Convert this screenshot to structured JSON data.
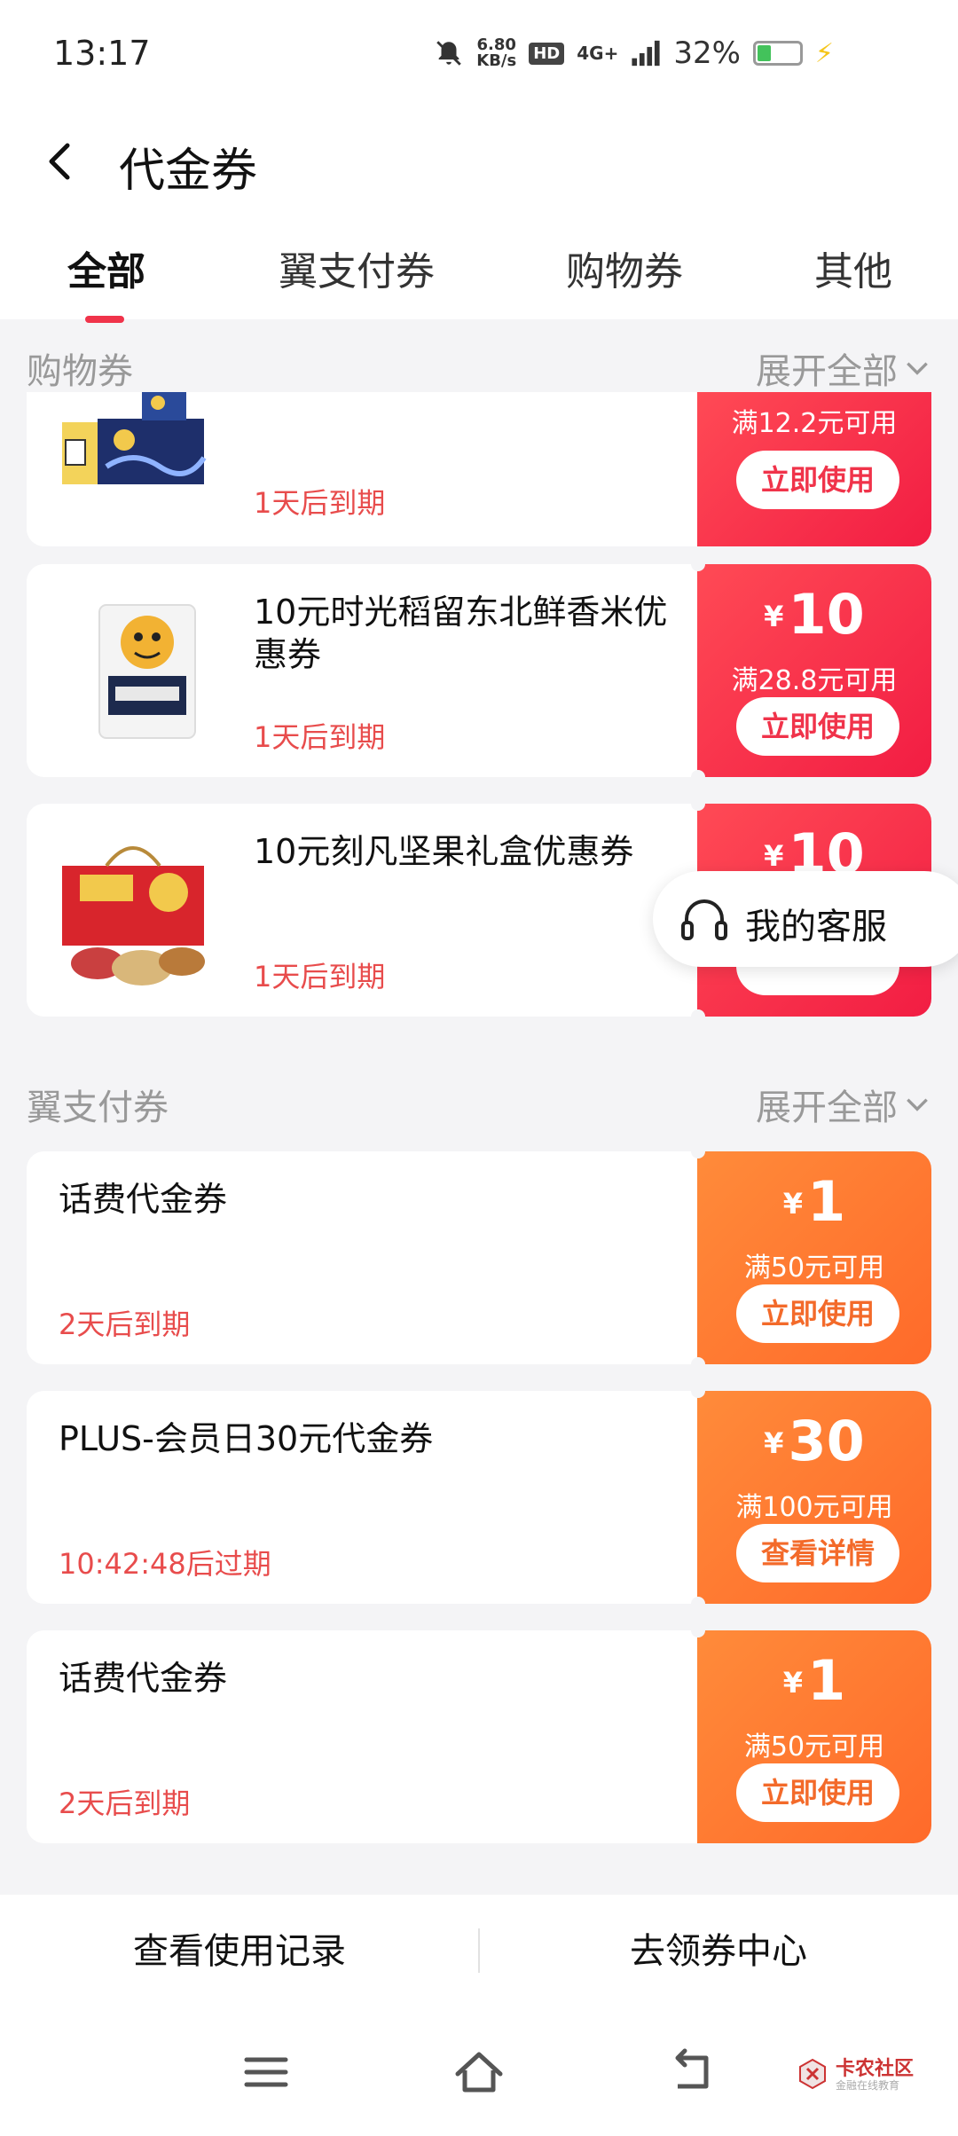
{
  "status": {
    "time": "13:17",
    "speed_value": "6.80",
    "speed_unit": "KB/s",
    "hd": "HD",
    "network": "4G+",
    "battery": "32%"
  },
  "header": {
    "title": "代金券",
    "tabs": [
      {
        "label": "全部",
        "active": true
      },
      {
        "label": "翼支付券",
        "active": false
      },
      {
        "label": "购物券",
        "active": false
      },
      {
        "label": "其他",
        "active": false
      }
    ]
  },
  "sections": {
    "shopping": {
      "title": "购物券",
      "expand": "展开全部"
    },
    "yipay": {
      "title": "翼支付券",
      "expand": "展开全部"
    }
  },
  "shopping_coupons": [
    {
      "title": "",
      "product_icon": "starry-night-gift-box-image",
      "expire": "1天后到期",
      "currency": "¥",
      "amount": "",
      "condition": "满12.2元可用",
      "button": "立即使用",
      "accent": "#f21d43"
    },
    {
      "title": "10元时光稻留东北鲜香米优惠券",
      "product_icon": "rice-bag-image",
      "expire": "1天后到期",
      "currency": "¥",
      "amount": "10",
      "condition": "满28.8元可用",
      "button": "立即使用",
      "accent": "#f21d43"
    },
    {
      "title": "10元刻凡坚果礼盒优惠券",
      "product_icon": "nut-gift-box-image",
      "expire": "1天后到期",
      "currency": "¥",
      "amount": "10",
      "condition": "",
      "button": "",
      "accent": "#f21d43"
    }
  ],
  "yipay_coupons": [
    {
      "title": "话费代金券",
      "expire": "2天后到期",
      "currency": "¥",
      "amount": "1",
      "condition": "满50元可用",
      "button": "立即使用",
      "accent": "#ff6a2a"
    },
    {
      "title": "PLUS-会员日30元代金券",
      "expire": "10:42:48后过期",
      "currency": "¥",
      "amount": "30",
      "condition": "满100元可用",
      "button": "查看详情",
      "accent": "#ff6a2a"
    },
    {
      "title": "话费代金券",
      "expire": "2天后到期",
      "currency": "¥",
      "amount": "1",
      "condition": "满50元可用",
      "button": "立即使用",
      "accent": "#ff6a2a"
    }
  ],
  "service": {
    "label": "我的客服",
    "icon": "headset-icon"
  },
  "bottom": {
    "history": "查看使用记录",
    "center": "去领券中心"
  },
  "nav": {
    "menu_icon": "menu-icon",
    "home_icon": "home-icon",
    "back_icon": "back-icon"
  },
  "watermark": {
    "name": "卡农社区",
    "sub": "金融在线教育"
  }
}
